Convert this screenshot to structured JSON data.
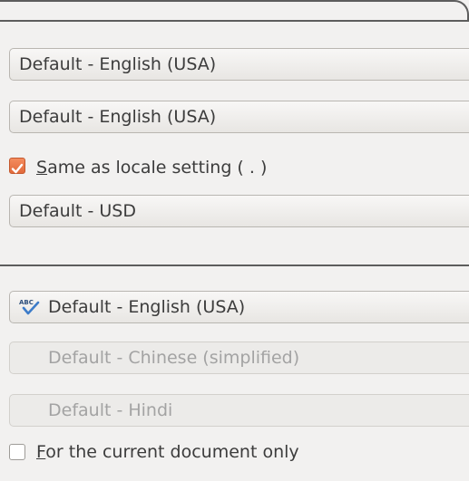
{
  "locale": {
    "locale_setting": "Default - English (USA)",
    "default_language": "Default - English (USA)"
  },
  "decimal_separator": {
    "mnemonic": "S",
    "rest": "ame as locale setting ( . )",
    "checked": true
  },
  "currency": {
    "value": "Default - USD"
  },
  "languages": {
    "western": "Default - English (USA)",
    "asian": "Default - Chinese (simplified)",
    "ctl": "Default - Hindi"
  },
  "current_document": {
    "mnemonic": "F",
    "rest": "or the current document only",
    "checked": false
  },
  "colors": {
    "accent": "#e8743f",
    "separator": "#5d5d5d",
    "disabled_text": "#a3a3a3"
  },
  "icons": {
    "spellcheck": "spellcheck-abc-icon"
  }
}
